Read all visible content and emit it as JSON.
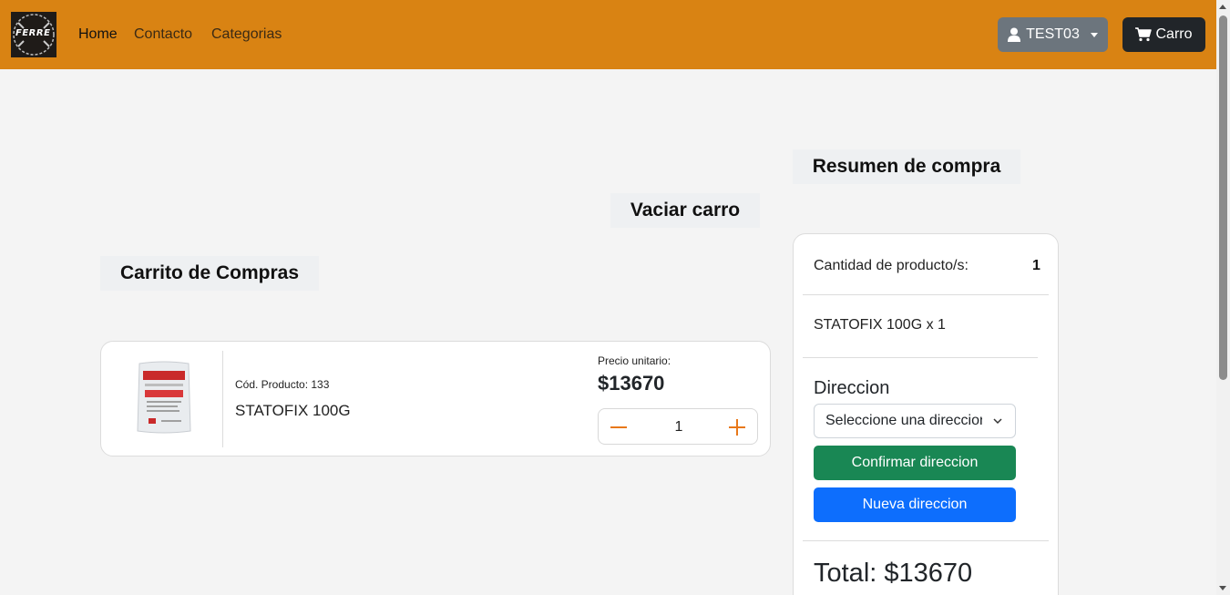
{
  "navbar": {
    "logo_text": "FERRE",
    "links": [
      "Home",
      "Contacto",
      "Categorias"
    ],
    "user_label": "TEST03",
    "cart_label": "Carro",
    "bg_color": "#d98313"
  },
  "headings": {
    "summary_title": "Resumen de compra",
    "empty_cart": "Vaciar carro",
    "cart_title": "Carrito de Compras"
  },
  "cart_item": {
    "code_label": "Cód. Producto: 133",
    "name": "STATOFIX 100G",
    "unit_price_label": "Precio unitario:",
    "price": "$13670",
    "quantity": "1",
    "image_icon": "product-bag-image"
  },
  "summary": {
    "qty_label": "Cantidad de producto/s:",
    "qty_value": "1",
    "line_item": "STATOFIX 100G x 1",
    "address_label": "Direccion",
    "address_select": "Seleccione una direccion",
    "confirm_button": "Confirmar direccion",
    "new_button": "Nueva direccion",
    "total": "Total: $13670"
  },
  "colors": {
    "confirm": "#198754",
    "new": "#0d6efd",
    "user_btn": "#6c757d",
    "cart_btn": "#212529",
    "qty_icons": "#e8781a"
  }
}
